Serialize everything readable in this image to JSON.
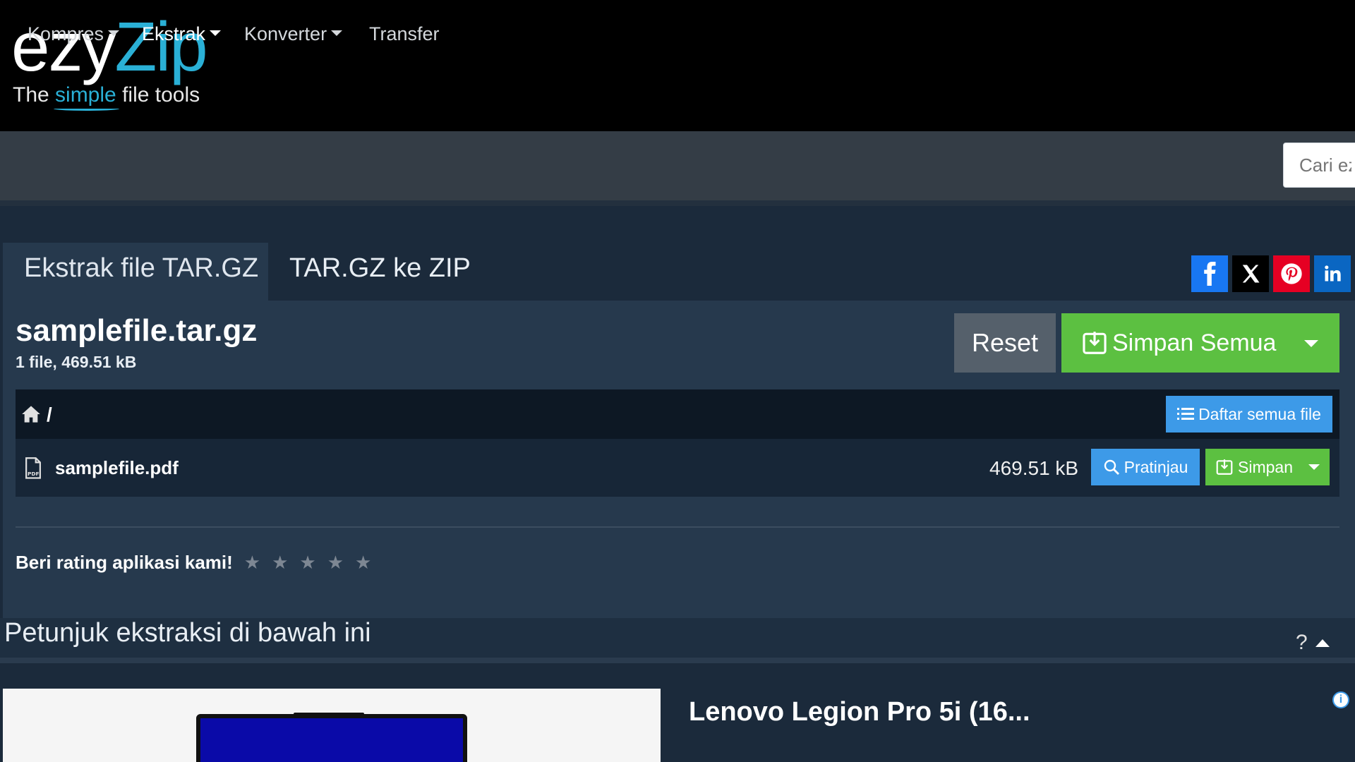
{
  "header": {
    "logo_ezy": "ezy",
    "logo_zip": "Zip",
    "tagline_pre": "The ",
    "tagline_simple": "simple",
    "tagline_post": " file tools"
  },
  "nav": {
    "items": [
      {
        "label": "Kompres",
        "dropdown": true
      },
      {
        "label": "Ekstrak",
        "dropdown": true,
        "active": true
      },
      {
        "label": "Konverter",
        "dropdown": true
      },
      {
        "label": "Transfer",
        "dropdown": false
      }
    ],
    "search_placeholder": "Cari ezyZip"
  },
  "tabs": [
    {
      "label": "Ekstrak file TAR.GZ",
      "active": true
    },
    {
      "label": "TAR.GZ ke ZIP",
      "active": false
    }
  ],
  "share": {
    "facebook": {
      "icon": "facebook-icon",
      "color": "#1877f2"
    },
    "x": {
      "icon": "x-icon",
      "color": "#000000"
    },
    "pinterest": {
      "icon": "pinterest-icon",
      "color": "#e60023"
    },
    "linkedin": {
      "icon": "linkedin-icon",
      "color": "#0a66c2"
    }
  },
  "archive": {
    "name": "samplefile.tar.gz",
    "info": "1 file, 469.51 kB",
    "reset_label": "Reset",
    "save_all_label": "Simpan Semua",
    "path": "/",
    "list_all_label": "Daftar semua file"
  },
  "files": [
    {
      "name": "samplefile.pdf",
      "size": "469.51 kB",
      "preview_label": "Pratinjau",
      "save_label": "Simpan"
    }
  ],
  "rating": {
    "label": "Beri rating aplikasi kami!",
    "stars": 5,
    "star_char": "★"
  },
  "instructions": {
    "title": "Petunjuk ekstraksi di bawah ini",
    "help": "?"
  },
  "ad": {
    "title": "Lenovo Legion Pro 5i (16...",
    "info": "i"
  },
  "colors": {
    "accent_blue": "#2ab0d6",
    "button_blue": "#3d9ae8",
    "button_green": "#5cc041",
    "panel": "#26394d"
  }
}
